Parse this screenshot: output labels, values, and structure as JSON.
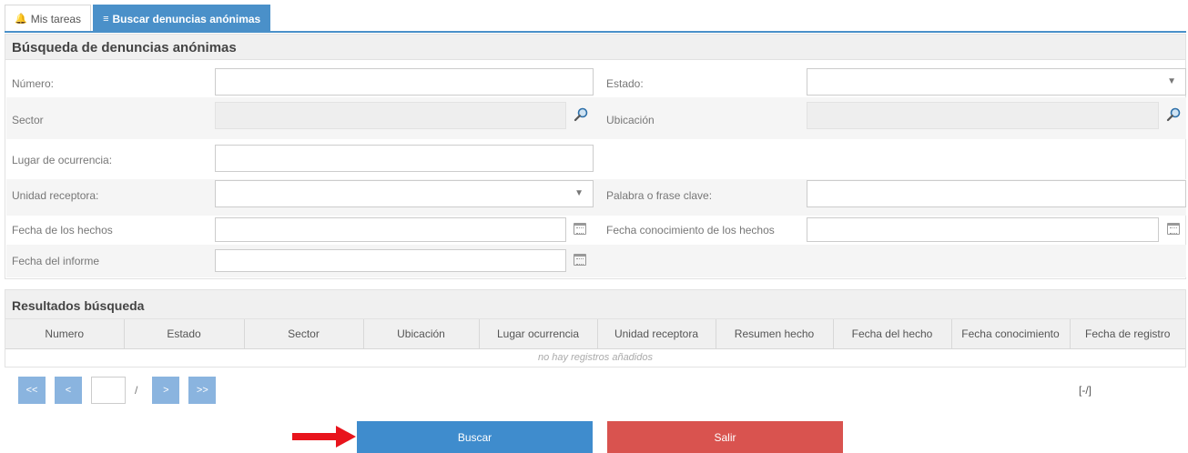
{
  "tabs": [
    {
      "label": "Mis tareas",
      "icon": "bell-icon"
    },
    {
      "label": "Buscar denuncias anónimas",
      "icon": "list-icon"
    }
  ],
  "search": {
    "title": "Búsqueda de denuncias anónimas",
    "fields": {
      "numero": {
        "label": "Número:",
        "value": ""
      },
      "estado": {
        "label": "Estado:",
        "value": ""
      },
      "sector": {
        "label": "Sector",
        "value": ""
      },
      "ubicacion": {
        "label": "Ubicación",
        "value": ""
      },
      "lugar": {
        "label": "Lugar de ocurrencia:",
        "value": ""
      },
      "unidad": {
        "label": "Unidad receptora:",
        "value": ""
      },
      "palabra": {
        "label": "Palabra o frase clave:",
        "value": ""
      },
      "fecha_hechos": {
        "label": "Fecha de los hechos",
        "value": ""
      },
      "fecha_conocimiento": {
        "label": "Fecha conocimiento de los hechos",
        "value": ""
      },
      "fecha_informe": {
        "label": "Fecha del informe",
        "value": ""
      }
    }
  },
  "results": {
    "title": "Resultados búsqueda",
    "columns": [
      "Numero",
      "Estado",
      "Sector",
      "Ubicación",
      "Lugar ocurrencia",
      "Unidad receptora",
      "Resumen hecho",
      "Fecha del hecho",
      "Fecha conocimiento",
      "Fecha de registro"
    ],
    "empty_text": "no hay registros añadidos"
  },
  "pager": {
    "first": "<<",
    "prev": "<",
    "next": ">",
    "last": ">>",
    "page_value": "",
    "separator": "/",
    "info": "[-/]"
  },
  "actions": {
    "search_label": "Buscar",
    "exit_label": "Salir"
  },
  "colors": {
    "primary": "#3f8ccd",
    "danger": "#d9534f",
    "annotation_arrow": "#e8141c"
  }
}
